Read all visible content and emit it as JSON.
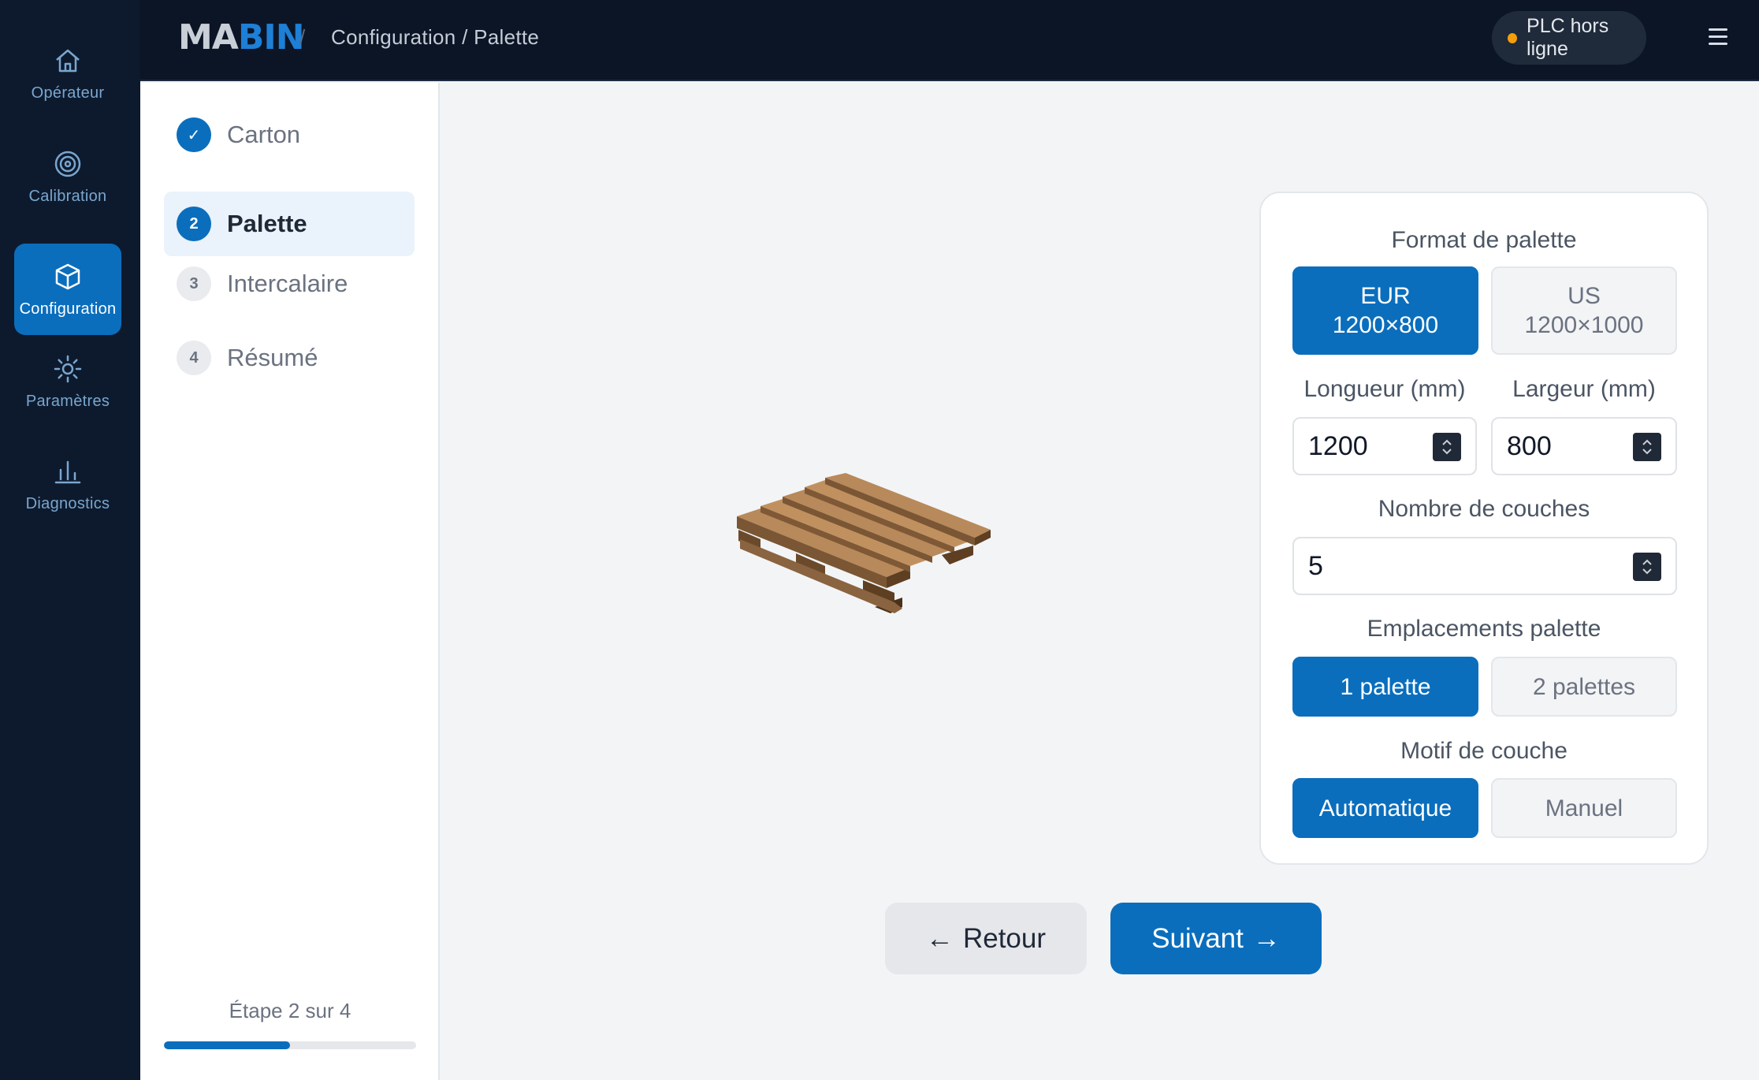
{
  "nav": {
    "items": [
      {
        "label": "Opérateur",
        "icon": "home-icon"
      },
      {
        "label": "Calibration",
        "icon": "target-icon"
      },
      {
        "label": "Configuration",
        "icon": "box-icon",
        "active": true
      },
      {
        "label": "Paramètres",
        "icon": "gear-icon"
      },
      {
        "label": "Diagnostics",
        "icon": "bar-chart-icon"
      }
    ]
  },
  "header": {
    "logo_part1": "M",
    "logo_part2": "A",
    "logo_part3": "B",
    "logo_part4": "IN",
    "separator": "/",
    "breadcrumb": "Configuration / Palette",
    "plc_status": "PLC hors ligne",
    "plc_status_color": "#f59e0b"
  },
  "steps": {
    "items": [
      {
        "number": "✓",
        "label": "Carton",
        "state": "done"
      },
      {
        "number": "2",
        "label": "Palette",
        "state": "current"
      },
      {
        "number": "3",
        "label": "Intercalaire",
        "state": "pending"
      },
      {
        "number": "4",
        "label": "Résumé",
        "state": "pending"
      }
    ],
    "progress_text": "Étape 2 sur 4",
    "progress_fraction": 0.5
  },
  "config": {
    "format_title": "Format de palette",
    "format_options": [
      {
        "line1": "EUR",
        "line2": "1200×800",
        "selected": true
      },
      {
        "line1": "US",
        "line2": "1200×1000",
        "selected": false
      }
    ],
    "length_label": "Longueur (mm)",
    "length_value": "1200",
    "width_label": "Largeur (mm)",
    "width_value": "800",
    "layers_title": "Nombre de couches",
    "layers_value": "5",
    "slots_title": "Emplacements palette",
    "slots_options": [
      {
        "label": "1 palette",
        "selected": true
      },
      {
        "label": "2 palettes",
        "selected": false
      }
    ],
    "pattern_title": "Motif de couche",
    "pattern_options": [
      {
        "label": "Automatique",
        "selected": true
      },
      {
        "label": "Manuel",
        "selected": false
      }
    ]
  },
  "footer_nav": {
    "back_label": "Retour",
    "back_arrow": "←",
    "next_label": "Suivant",
    "next_arrow": "→"
  },
  "colors": {
    "accent": "#0a6ebd",
    "rail_bg": "#0d1a2d",
    "topbar_bg": "#0b1526"
  }
}
